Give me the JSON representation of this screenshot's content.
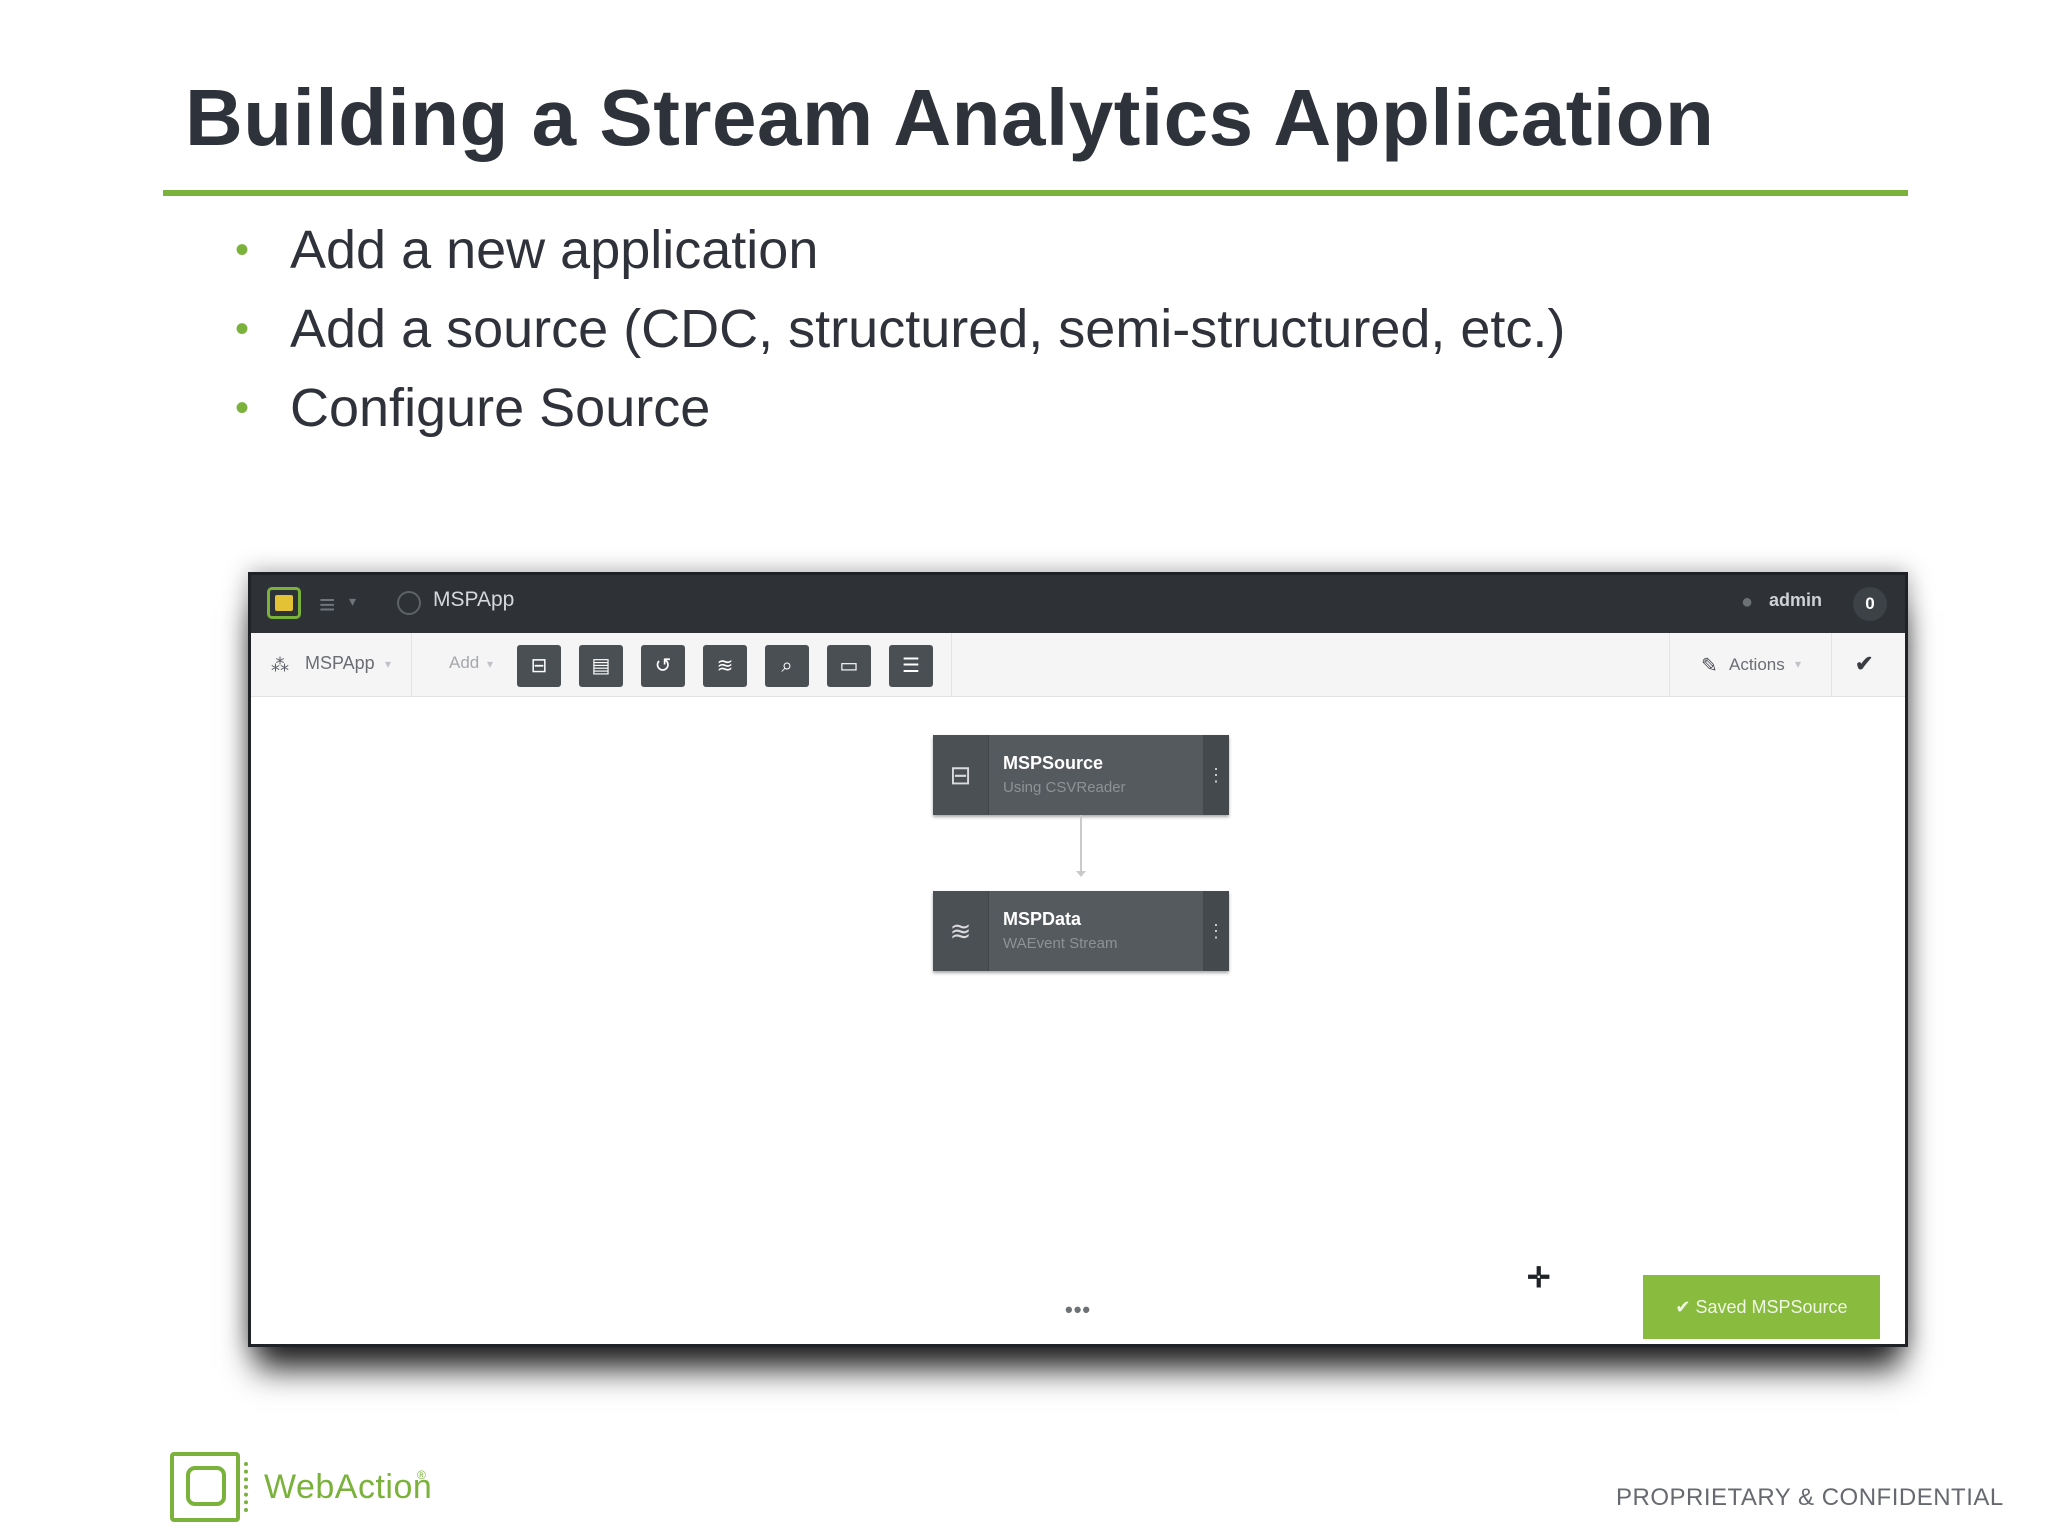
{
  "slide": {
    "title": "Building a Stream Analytics Application",
    "bullets": [
      "Add a new application",
      "Add a source (CDC, structured, semi-structured, etc.)",
      "Configure Source"
    ]
  },
  "app_window": {
    "topbar": {
      "app_title": "MSPApp",
      "user": "admin",
      "notification_count": "0"
    },
    "toolbar": {
      "app_dropdown": "MSPApp",
      "add_label": "Add",
      "tools": [
        "source-icon",
        "cache-icon",
        "query-icon",
        "stream-icon",
        "search-icon",
        "comment-icon",
        "database-icon"
      ],
      "actions_label": "Actions"
    },
    "canvas": {
      "nodes": [
        {
          "title": "MSPSource",
          "subtitle": "Using CSVReader",
          "icon": "source-icon"
        },
        {
          "title": "MSPData",
          "subtitle": "WAEvent Stream",
          "icon": "stream-icon"
        }
      ],
      "more_label": "•••",
      "toast": "✔ Saved MSPSource"
    },
    "colors": {
      "accent": "#7bb23c",
      "toast": "#89bb3e",
      "node": "#555a5f",
      "topbar": "#2e3237"
    }
  },
  "footer": {
    "brand": "WebAction",
    "brand_mark": "®",
    "confidential": "PROPRIETARY & CONFIDENTIAL"
  }
}
